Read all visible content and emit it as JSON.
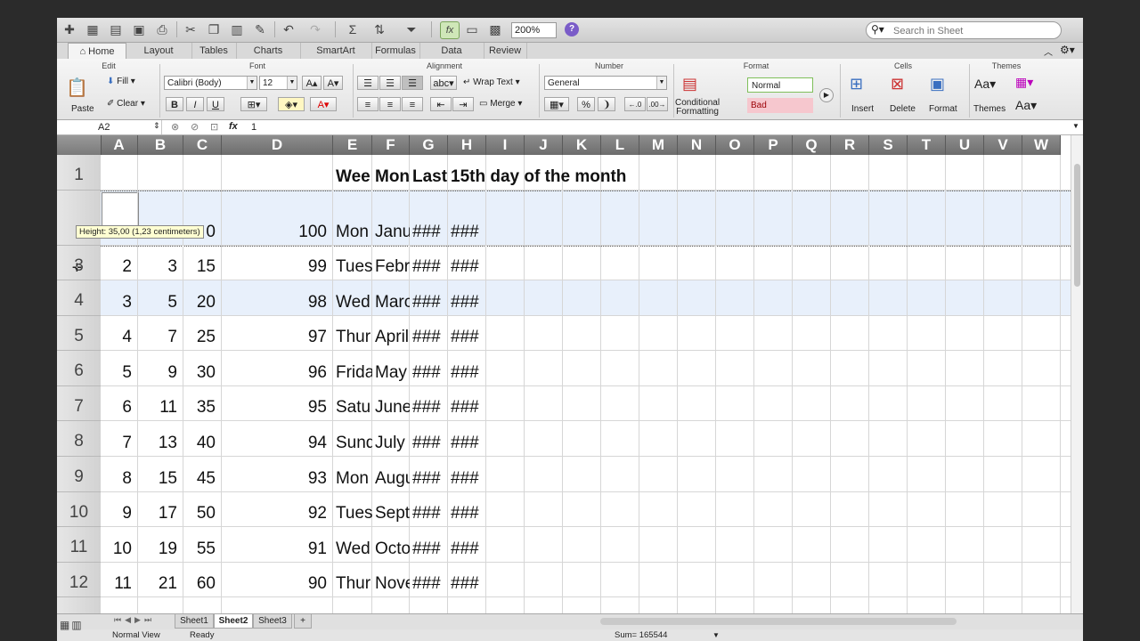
{
  "toolbar": {
    "zoom": "200%",
    "search_placeholder": "Search in Sheet"
  },
  "tabs": [
    "Home",
    "Layout",
    "Tables",
    "Charts",
    "SmartArt",
    "Formulas",
    "Data",
    "Review"
  ],
  "ribbon": {
    "groups": {
      "edit": "Edit",
      "font": "Font",
      "alignment": "Alignment",
      "number": "Number",
      "format": "Format",
      "cells": "Cells",
      "themes": "Themes"
    },
    "paste": "Paste",
    "fill": "Fill",
    "clear": "Clear",
    "font_name": "Calibri (Body)",
    "font_size": "12",
    "bold": "B",
    "italic": "I",
    "underline": "U",
    "wrap_text": "Wrap Text",
    "merge": "Merge",
    "abc": "abc",
    "number_format": "General",
    "percent": "%",
    "conditional_formatting_1": "Conditional",
    "conditional_formatting_2": "Formatting",
    "style_normal": "Normal",
    "style_bad": "Bad",
    "insert": "Insert",
    "delete": "Delete",
    "format": "Format",
    "themes": "Themes"
  },
  "formula_bar": {
    "name_box": "A2",
    "fx": "fx",
    "content": "1"
  },
  "columns": [
    "A",
    "B",
    "C",
    "D",
    "E",
    "F",
    "G",
    "H",
    "I",
    "J",
    "K",
    "L",
    "M",
    "N",
    "O",
    "P",
    "Q",
    "R",
    "S",
    "T",
    "U",
    "V",
    "W"
  ],
  "rows": {
    "r1": {
      "num": "1",
      "E": "Wee",
      "F": "Mon",
      "G": "Last",
      "H": "15th day of the month"
    },
    "r2": {
      "num": "",
      "C": "0",
      "D": "100",
      "E": "Mon",
      "F": "Janu",
      "G": "###",
      "H": "###"
    },
    "r3": {
      "num": "3",
      "A": "2",
      "B": "3",
      "C": "15",
      "D": "99",
      "E": "Tues",
      "F": "Febr",
      "G": "###",
      "H": "###"
    },
    "r4": {
      "num": "4",
      "A": "3",
      "B": "5",
      "C": "20",
      "D": "98",
      "E": "Wed",
      "F": "Marc",
      "G": "###",
      "H": "###"
    },
    "r5": {
      "num": "5",
      "A": "4",
      "B": "7",
      "C": "25",
      "D": "97",
      "E": "Thur",
      "F": "April",
      "G": "###",
      "H": "###"
    },
    "r6": {
      "num": "6",
      "A": "5",
      "B": "9",
      "C": "30",
      "D": "96",
      "E": "Frida",
      "F": "May",
      "G": "###",
      "H": "###"
    },
    "r7": {
      "num": "7",
      "A": "6",
      "B": "11",
      "C": "35",
      "D": "95",
      "E": "Satu",
      "F": "June",
      "G": "###",
      "H": "###"
    },
    "r8": {
      "num": "8",
      "A": "7",
      "B": "13",
      "C": "40",
      "D": "94",
      "E": "Sund",
      "F": "July",
      "G": "###",
      "H": "###"
    },
    "r9": {
      "num": "9",
      "A": "8",
      "B": "15",
      "C": "45",
      "D": "93",
      "E": "Mon",
      "F": "Augu",
      "G": "###",
      "H": "###"
    },
    "r10": {
      "num": "10",
      "A": "9",
      "B": "17",
      "C": "50",
      "D": "92",
      "E": "Tues",
      "F": "Sept",
      "G": "###",
      "H": "###"
    },
    "r11": {
      "num": "11",
      "A": "10",
      "B": "19",
      "C": "55",
      "D": "91",
      "E": "Wed",
      "F": "Octo",
      "G": "###",
      "H": "###"
    },
    "r12": {
      "num": "12",
      "A": "11",
      "B": "21",
      "C": "60",
      "D": "90",
      "E": "Thur",
      "F": "Nove",
      "G": "###",
      "H": "###"
    }
  },
  "tooltip": "Height: 35,00 (1,23 centimeters)",
  "sheets": [
    "Sheet1",
    "Sheet2",
    "Sheet3",
    "+"
  ],
  "status": {
    "view": "Normal View",
    "ready": "Ready",
    "sum": "Sum= 165544"
  },
  "colors": {
    "row_highlight": "#e8f0fb",
    "header_dark": "#7a7a7a",
    "bad_style": "#f6c7ce",
    "normal_style_border": "#7fbf5a"
  }
}
